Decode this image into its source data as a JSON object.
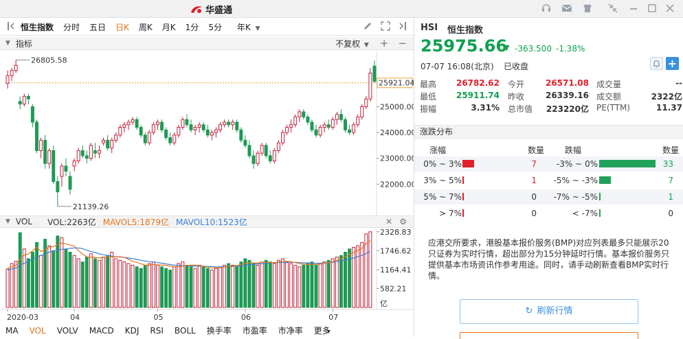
{
  "app": {
    "logo_text": "华盛通"
  },
  "toolbar": {
    "index_name": "恒生指数",
    "periods": [
      "分时",
      "五日",
      "日K",
      "周K",
      "月K",
      "1分",
      "5分"
    ],
    "active_period": "日K",
    "kline_type": "年K",
    "adjust": "不复权"
  },
  "indicator_bar": {
    "label": "指标"
  },
  "kchart": {
    "high_label": "26805.58",
    "low_label": "21139.26",
    "last_price_label": "25921.04",
    "ticks": [
      "25000.00",
      "24000.00",
      "23000.00",
      "22000.00"
    ],
    "tick_values": [
      25000,
      24000,
      23000,
      22000
    ],
    "ylim": [
      21000,
      26950
    ],
    "ref_price": 25921.04
  },
  "vol_bar": {
    "label": "VOL",
    "vol": "VOL:2263亿",
    "ma5": "MAVOL5:1879亿",
    "ma10": "MAVOL10:1523亿",
    "ma5_color": "#e8741b",
    "ma10_color": "#3a7fd5"
  },
  "volchart": {
    "ticks": [
      "2328.83",
      "1746.62",
      "1164.41",
      "582.21"
    ],
    "tick_values": [
      2328.83,
      1746.62,
      1164.41,
      582.21
    ],
    "unit": "亿",
    "ymax": 2450
  },
  "xaxis": {
    "labels": [
      "2020-03",
      "04",
      "05",
      "06",
      "07"
    ],
    "label_index": [
      0,
      16,
      36,
      57,
      78
    ]
  },
  "bottom_tabs": [
    "MA",
    "VOL",
    "VOLV",
    "MACD",
    "KDJ",
    "RSI",
    "BOLL",
    "换手率",
    "市盈率",
    "市净率",
    "更多"
  ],
  "active_bottom_tab": "VOL",
  "quote": {
    "code": "HSI",
    "name": "恒生指数",
    "price": "25975.66",
    "change": "-363.500",
    "change_pct": "-1.38%",
    "datetime": "07-07  16:08(北京)",
    "status": "已收盘",
    "stats": [
      {
        "label": "最高",
        "value": "26782.62",
        "color": "red"
      },
      {
        "label": "今开",
        "value": "26571.08",
        "color": "red"
      },
      {
        "label": "成交量",
        "value": "--",
        "color": ""
      },
      {
        "label": "最低",
        "value": "25911.74",
        "color": "green"
      },
      {
        "label": "昨收",
        "value": "26339.16",
        "color": ""
      },
      {
        "label": "成交额",
        "value": "2322亿",
        "color": ""
      },
      {
        "label": "振幅",
        "value": "3.31%",
        "color": ""
      },
      {
        "label": "总市值",
        "value": "223220亿",
        "color": ""
      },
      {
        "label": "PE(TTM)",
        "value": "11.37",
        "color": ""
      }
    ]
  },
  "distribution": {
    "title": "涨跌分布",
    "col_up": "涨幅",
    "col_count": "数量",
    "col_down": "跌幅",
    "up": [
      {
        "range": "0% ~ 3%",
        "count": "7",
        "n": 7
      },
      {
        "range": "3% ~ 5%",
        "count": "1",
        "n": 1
      },
      {
        "range": "5% ~ 7%",
        "count": "0",
        "n": 0
      },
      {
        "range": "> 7%",
        "count": "0",
        "n": 0
      }
    ],
    "down": [
      {
        "range": "-3% ~ 0%",
        "count": "33",
        "n": 33
      },
      {
        "range": "-5% ~ -3%",
        "count": "7",
        "n": 7
      },
      {
        "range": "-7% ~ -5%",
        "count": "1",
        "n": 1
      },
      {
        "range": "< -7%",
        "count": "0",
        "n": 0
      }
    ],
    "up_color": "#e0202a",
    "down_color": "#21a25a"
  },
  "notice": "应港交所要求，港股基本报价服务(BMP)对应列表最多只能展示20只证券为实时行情，超出部分为15分钟延时行情。基本报价服务只提供基本市场资讯作参考用途。同时，请手动刷新查看BMP实时行情。",
  "refresh_button": "刷新行情",
  "candles": [
    [
      25900,
      26400,
      25700,
      26200
    ],
    [
      26200,
      26500,
      26000,
      26400
    ],
    [
      26400,
      26805.58,
      26300,
      26600
    ],
    [
      25200,
      25400,
      24900,
      25100
    ],
    [
      25100,
      25500,
      25000,
      25400
    ],
    [
      25400,
      25500,
      25100,
      25300
    ],
    [
      25000,
      25100,
      24200,
      24400
    ],
    [
      24400,
      24500,
      23200,
      23300
    ],
    [
      23300,
      23800,
      23000,
      23700
    ],
    [
      23700,
      23900,
      22600,
      22800
    ],
    [
      22800,
      23400,
      22600,
      23300
    ],
    [
      23300,
      23500,
      22000,
      22100
    ],
    [
      22100,
      22300,
      21139.26,
      21700
    ],
    [
      22300,
      22800,
      21900,
      22700
    ],
    [
      22700,
      23000,
      22300,
      22500
    ],
    [
      22300,
      22500,
      21600,
      21800
    ],
    [
      22700,
      23000,
      22500,
      22900
    ],
    [
      22900,
      23400,
      22800,
      23300
    ],
    [
      23300,
      23500,
      23000,
      23100
    ],
    [
      23100,
      23300,
      22800,
      23000
    ],
    [
      23000,
      23600,
      22900,
      23500
    ],
    [
      23300,
      23600,
      23000,
      23200
    ],
    [
      23200,
      23500,
      23000,
      23300
    ],
    [
      23600,
      23800,
      23500,
      23700
    ],
    [
      23700,
      23900,
      23300,
      23400
    ],
    [
      23400,
      23800,
      23200,
      23700
    ],
    [
      23700,
      24000,
      23600,
      23900
    ],
    [
      23900,
      24300,
      23800,
      24200
    ],
    [
      24200,
      24400,
      24000,
      24300
    ],
    [
      24300,
      24500,
      24100,
      24400
    ],
    [
      24400,
      24600,
      24300,
      24500
    ],
    [
      24500,
      24600,
      24100,
      24200
    ],
    [
      24200,
      24300,
      23800,
      23900
    ],
    [
      23900,
      24000,
      23500,
      23600
    ],
    [
      23600,
      24100,
      23500,
      24000
    ],
    [
      24000,
      24400,
      23900,
      24300
    ],
    [
      24300,
      24500,
      24100,
      24400
    ],
    [
      24400,
      24500,
      24000,
      24100
    ],
    [
      24100,
      24200,
      23700,
      23800
    ],
    [
      23800,
      24000,
      23500,
      23600
    ],
    [
      23600,
      24000,
      23500,
      23900
    ],
    [
      23900,
      24300,
      23800,
      24200
    ],
    [
      24200,
      24600,
      24100,
      24500
    ],
    [
      24500,
      24700,
      24200,
      24300
    ],
    [
      24300,
      24500,
      24000,
      24100
    ],
    [
      24100,
      24300,
      23900,
      24200
    ],
    [
      24200,
      24400,
      24000,
      24300
    ],
    [
      24300,
      24400,
      24000,
      24100
    ],
    [
      24100,
      24300,
      23800,
      23900
    ],
    [
      23900,
      24100,
      23700,
      24000
    ],
    [
      24000,
      24200,
      23800,
      24100
    ],
    [
      24100,
      24400,
      24000,
      24300
    ],
    [
      24300,
      24500,
      24200,
      24400
    ],
    [
      24400,
      24500,
      24200,
      24300
    ],
    [
      24300,
      24500,
      24100,
      24400
    ],
    [
      24400,
      24500,
      24000,
      24100
    ],
    [
      24100,
      24200,
      23600,
      23700
    ],
    [
      23700,
      23900,
      23400,
      23500
    ],
    [
      23500,
      23700,
      23000,
      23100
    ],
    [
      23100,
      23300,
      22600,
      22800
    ],
    [
      22800,
      23300,
      22700,
      23200
    ],
    [
      23200,
      23600,
      23100,
      23500
    ],
    [
      23500,
      23600,
      23000,
      23100
    ],
    [
      23100,
      23300,
      22800,
      22900
    ],
    [
      22900,
      23400,
      22800,
      23300
    ],
    [
      23300,
      23700,
      23200,
      23600
    ],
    [
      23600,
      24100,
      23500,
      24000
    ],
    [
      24000,
      24300,
      23900,
      24200
    ],
    [
      24200,
      24500,
      24000,
      24300
    ],
    [
      24300,
      24700,
      24200,
      24600
    ],
    [
      24600,
      24900,
      24400,
      24800
    ],
    [
      24800,
      24900,
      24500,
      24600
    ],
    [
      24600,
      24700,
      24300,
      24400
    ],
    [
      24400,
      24500,
      24000,
      24100
    ],
    [
      24100,
      24300,
      23800,
      23900
    ],
    [
      23900,
      24300,
      23800,
      24200
    ],
    [
      24200,
      24400,
      24000,
      24300
    ],
    [
      24300,
      24500,
      24100,
      24200
    ],
    [
      24200,
      24600,
      24100,
      24500
    ],
    [
      24500,
      24800,
      24300,
      24700
    ],
    [
      24700,
      24900,
      24400,
      24500
    ],
    [
      24500,
      24600,
      24000,
      24100
    ],
    [
      24100,
      24300,
      23900,
      24000
    ],
    [
      24000,
      24400,
      23900,
      24300
    ],
    [
      24300,
      24700,
      24200,
      24600
    ],
    [
      24600,
      25100,
      24500,
      25000
    ],
    [
      25000,
      25400,
      24900,
      25300
    ],
    [
      25300,
      26500,
      25200,
      26300
    ],
    [
      26571.08,
      26782.62,
      25911.74,
      25975.66
    ]
  ],
  "volumes": [
    1180,
    1350,
    1420,
    2300,
    1800,
    1500,
    1700,
    2000,
    1600,
    2100,
    1900,
    1750,
    2200,
    2150,
    1800,
    1700,
    1600,
    1500,
    1400,
    1550,
    1650,
    1500,
    1450,
    1550,
    1600,
    1700,
    1500,
    1450,
    1400,
    1350,
    1300,
    1250,
    1200,
    1300,
    1350,
    1400,
    1300,
    1250,
    1200,
    1150,
    1250,
    1350,
    1400,
    1300,
    1250,
    1200,
    1300,
    1250,
    1200,
    1150,
    1200,
    1250,
    1300,
    1350,
    1300,
    1250,
    1400,
    1500,
    1450,
    1350,
    1300,
    1400,
    1450,
    1400,
    1350,
    1450,
    1500,
    1400,
    1350,
    1300,
    1250,
    1300,
    1350,
    1400,
    1300,
    1350,
    1400,
    1450,
    1500,
    1550,
    1600,
    1700,
    1800,
    1850,
    1900,
    2000,
    2263,
    2328.83
  ],
  "vol_ma5": [
    1200,
    1250,
    1300,
    1500,
    1610,
    1650,
    1740,
    1860,
    1720,
    1780,
    1860,
    1870,
    1930,
    1980,
    1960,
    1920,
    1890,
    1750,
    1640,
    1560,
    1540,
    1540,
    1520,
    1540,
    1560,
    1560,
    1560,
    1560,
    1540,
    1480,
    1420,
    1390,
    1340,
    1300,
    1300,
    1320,
    1310,
    1300,
    1290,
    1270,
    1250,
    1250,
    1270,
    1290,
    1300,
    1300,
    1290,
    1260,
    1240,
    1220,
    1220,
    1220,
    1240,
    1260,
    1280,
    1290,
    1320,
    1360,
    1380,
    1370,
    1360,
    1400,
    1390,
    1380,
    1370,
    1400,
    1420,
    1420,
    1410,
    1380,
    1350,
    1330,
    1320,
    1330,
    1320,
    1340,
    1360,
    1380,
    1410,
    1450,
    1500,
    1560,
    1630,
    1690,
    1750,
    1820,
    1960,
    2060
  ],
  "vol_ma10": [
    1150,
    1180,
    1210,
    1300,
    1360,
    1420,
    1480,
    1560,
    1600,
    1650,
    1700,
    1740,
    1760,
    1790,
    1800,
    1820,
    1830,
    1830,
    1810,
    1760,
    1720,
    1690,
    1650,
    1620,
    1600,
    1580,
    1560,
    1550,
    1540,
    1520,
    1500,
    1480,
    1450,
    1430,
    1410,
    1400,
    1380,
    1360,
    1340,
    1320,
    1300,
    1290,
    1280,
    1280,
    1280,
    1270,
    1270,
    1270,
    1260,
    1260,
    1250,
    1250,
    1250,
    1260,
    1260,
    1270,
    1280,
    1300,
    1320,
    1330,
    1340,
    1350,
    1360,
    1370,
    1380,
    1380,
    1380,
    1380,
    1390,
    1390,
    1380,
    1370,
    1370,
    1360,
    1360,
    1360,
    1370,
    1380,
    1390,
    1410,
    1430,
    1460,
    1490,
    1520,
    1560,
    1600,
    1660,
    1720
  ]
}
